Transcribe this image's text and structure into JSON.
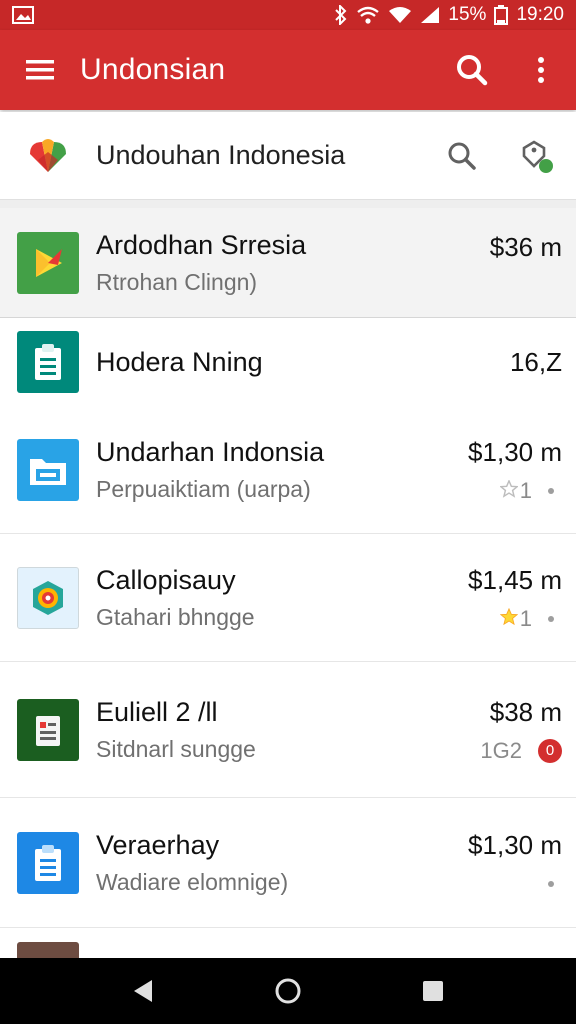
{
  "status_bar": {
    "battery_percent": "15%",
    "time": "19:20",
    "icons": [
      "image-icon",
      "bluetooth-icon",
      "wifi-icon",
      "wifi-icon",
      "signal-icon",
      "battery-icon"
    ]
  },
  "app_bar": {
    "title": "Undonsian",
    "icons": [
      "menu-icon",
      "search-icon",
      "more-vert-icon"
    ]
  },
  "search_row": {
    "text": "Undouhan Indonesia",
    "icons": [
      "app-logo-icon",
      "search-icon",
      "filter-tag-icon"
    ]
  },
  "list": {
    "items": [
      {
        "title": "Ardodhan Srresia",
        "subtitle": "Rtrohan Clingn)",
        "price": "$36  m",
        "extra": "",
        "icon": "play-store-icon",
        "color": "#43a047"
      },
      {
        "title": "Hodera Nning",
        "subtitle": "",
        "price": "16,Z",
        "extra": "",
        "icon": "clipboard-icon",
        "color": "#00897b"
      },
      {
        "title": "Undarhan Indonsia",
        "subtitle": "Perpuaiktiam (uarpa)",
        "price": "$1,30  m",
        "extra": "1",
        "icon": "folder-icon",
        "color": "#29a3e6"
      },
      {
        "title": "Callopisauy",
        "subtitle": "Gtahari bhngge",
        "price": "$1,45  m",
        "extra": "1",
        "icon": "spiral-icon",
        "color": "#e3f2fd"
      },
      {
        "title": "Euliell 2 /ll",
        "subtitle": "Sitdnarl sungge",
        "price": "$38  m",
        "extra": "1G2",
        "icon": "notebook-icon",
        "color": "#2e7d32"
      },
      {
        "title": "Veraerhay",
        "subtitle": "Wadiare elomnige)",
        "price": "$1,30  m",
        "extra": "",
        "icon": "document-icon",
        "color": "#1e88e5"
      }
    ]
  },
  "colors": {
    "status_bar": "#c62828",
    "app_bar": "#d32f2f",
    "nav_bar": "#000000"
  },
  "nav_bar": {
    "icons": [
      "back-icon",
      "home-icon",
      "recents-icon"
    ]
  }
}
